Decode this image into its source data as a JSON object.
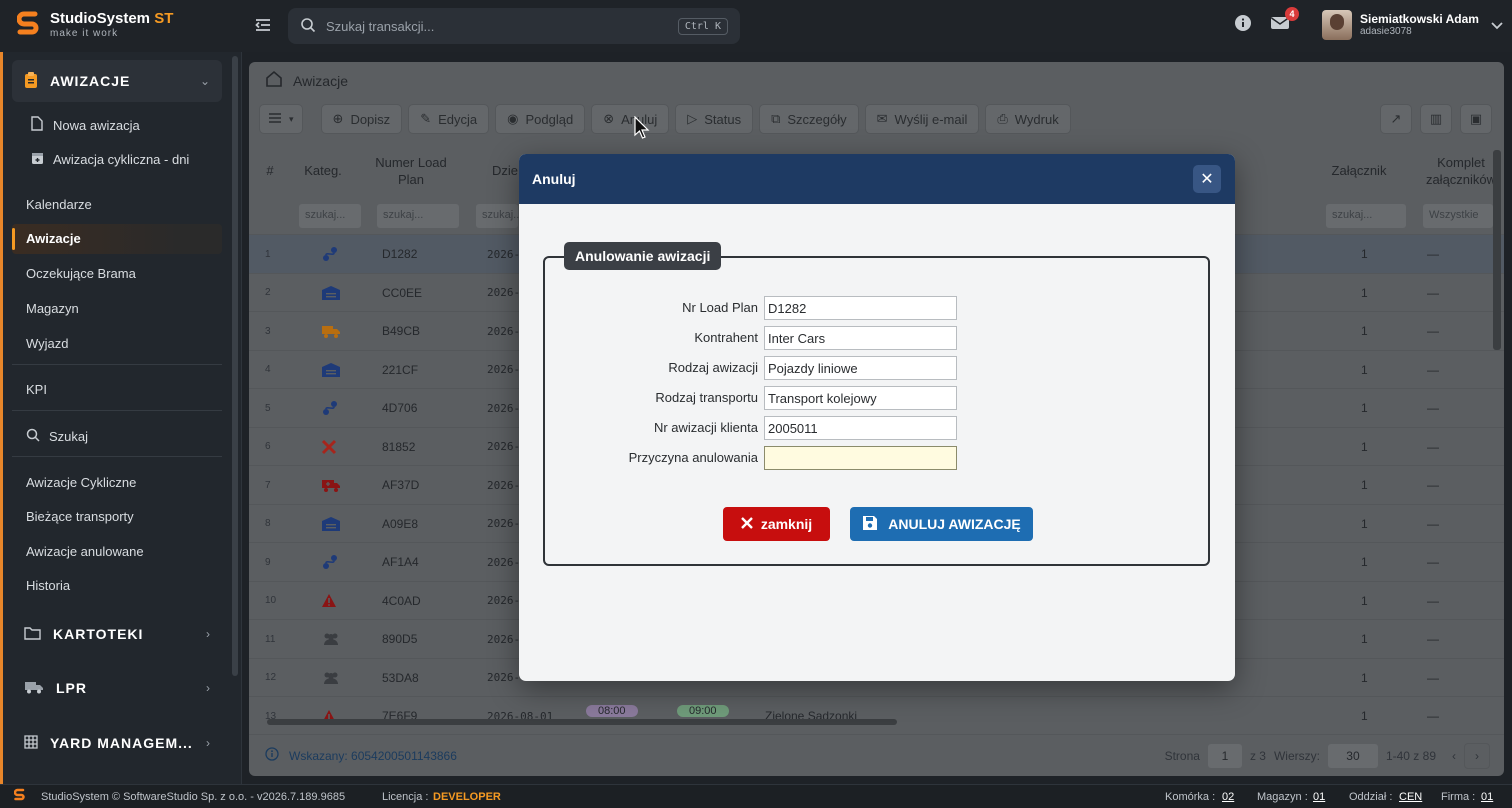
{
  "app": {
    "title_main": "StudioSystem",
    "title_accent": " ST",
    "tagline": "make it work"
  },
  "search": {
    "placeholder": "Szukaj transakcji...",
    "shortcut": "Ctrl K"
  },
  "notifications": {
    "count": "4"
  },
  "user": {
    "name": "Siemiatkowski Adam",
    "login": "adasie3078"
  },
  "sidebar": {
    "section_main": "AWIZACJE",
    "sub_items": [
      "Nowa awizacja",
      "Awizacja cykliczna - dni"
    ],
    "items_a": [
      "Kalendarze",
      "Awizacje",
      "Oczekujące Brama",
      "Magazyn",
      "Wyjazd"
    ],
    "kpi": "KPI",
    "search": "Szukaj",
    "items_b": [
      "Awizacje Cykliczne",
      "Bieżące transporty",
      "Awizacje anulowane",
      "Historia"
    ],
    "sections": [
      "KARTOTEKI",
      "LPR",
      "YARD MANAGEM..."
    ]
  },
  "breadcrumb": "Awizacje",
  "toolbar": [
    "Dopisz",
    "Edycja",
    "Podgląd",
    "Anuluj",
    "Status",
    "Szczegóły",
    "Wyślij e-mail",
    "Wydruk"
  ],
  "grid": {
    "headers": {
      "idx": "#",
      "kateg": "Kateg.",
      "numer": "Numer Load Plan",
      "dzien": "Dzie",
      "zalacznik": "Załącznik",
      "komplet": "Komplet załączników"
    },
    "filter_placeholder": "szukaj...",
    "filter_all": "Wszystkie",
    "rows": [
      {
        "n": "1",
        "code": "D1282",
        "date": "2026-",
        "att": "1",
        "comp": "—"
      },
      {
        "n": "2",
        "code": "CC0EE",
        "date": "2026-",
        "att": "1",
        "comp": "—"
      },
      {
        "n": "3",
        "code": "B49CB",
        "date": "2026-",
        "att": "1",
        "comp": "—"
      },
      {
        "n": "4",
        "code": "221CF",
        "date": "2026-",
        "att": "1",
        "comp": "—"
      },
      {
        "n": "5",
        "code": "4D706",
        "date": "2026-",
        "att": "1",
        "comp": "—"
      },
      {
        "n": "6",
        "code": "81852",
        "date": "2026-",
        "att": "1",
        "comp": "—"
      },
      {
        "n": "7",
        "code": "AF37D",
        "date": "2026-",
        "att": "1",
        "comp": "—"
      },
      {
        "n": "8",
        "code": "A09E8",
        "date": "2026-",
        "att": "1",
        "comp": "—"
      },
      {
        "n": "9",
        "code": "AF1A4",
        "date": "2026-",
        "att": "1",
        "comp": "—"
      },
      {
        "n": "10",
        "code": "4C0AD",
        "date": "2026-",
        "att": "1",
        "comp": "—"
      },
      {
        "n": "11",
        "code": "890D5",
        "date": "2026-",
        "att": "1",
        "comp": "—"
      },
      {
        "n": "12",
        "code": "53DA8",
        "date": "2026-",
        "att": "1",
        "comp": "—"
      },
      {
        "n": "13",
        "code": "7E6F9",
        "date": "2026-08-01",
        "att": "1",
        "comp": "—"
      }
    ],
    "row13": {
      "t1": "08:00",
      "t2": "09:00",
      "place": "Zielone Sadzonki"
    }
  },
  "footer": {
    "selected": "Wskazany: 6054200501143866",
    "page_label": "Strona",
    "page": "1",
    "of": "z 3",
    "rows_label": "Wierszy:",
    "rows": "30",
    "range": "1-40 z 89"
  },
  "statusbar": {
    "copyright": "StudioSystem © SoftwareStudio Sp. z o.o. - v2026.7.189.9685",
    "license_label": "Licencja :",
    "license": "DEVELOPER",
    "komorka_label": "Komórka :",
    "komorka": "02",
    "magazyn_label": "Magazyn :",
    "magazyn": "01",
    "oddzial_label": "Oddział :",
    "oddzial": "CEN",
    "firma_label": "Firma :",
    "firma": "01"
  },
  "modal": {
    "title": "Anuluj",
    "legend": "Anulowanie awizacji",
    "fields": [
      {
        "label": "Nr Load Plan",
        "value": "D1282"
      },
      {
        "label": "Kontrahent",
        "value": "Inter Cars"
      },
      {
        "label": "Rodzaj awizacji",
        "value": "Pojazdy liniowe"
      },
      {
        "label": "Rodzaj transportu",
        "value": "Transport kolejowy"
      },
      {
        "label": "Nr awizacji klienta",
        "value": "2005011"
      },
      {
        "label": "Przyczyna anulowania",
        "value": ""
      }
    ],
    "btn_close": "zamknij",
    "btn_cancel": "ANULUJ AWIZACJĘ"
  },
  "colors": {
    "accent": "#f59a23",
    "modal_header": "#1e3a63",
    "danger": "#c70e0e",
    "primary": "#1e6db2"
  }
}
